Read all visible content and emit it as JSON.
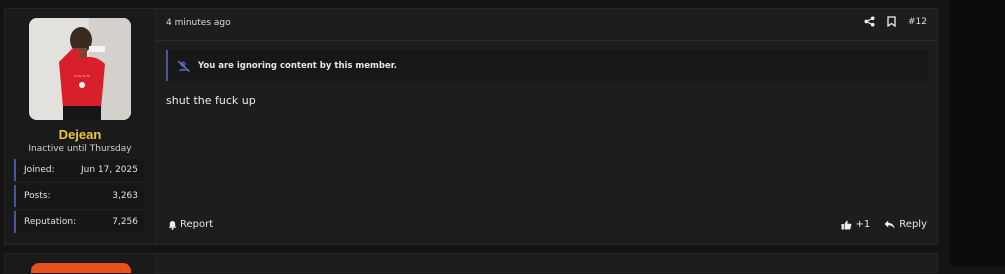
{
  "post": {
    "timestamp": "4 minutes ago",
    "post_number": "#12",
    "ignored_notice": "You are ignoring content by this member.",
    "message": "shut the fuck up",
    "report_label": "Report",
    "reaction_count": "+1",
    "reply_label": "Reply"
  },
  "user": {
    "name": "Dejean",
    "title": "Inactive until Thursday",
    "name_color": "#f0c63b",
    "stats": [
      {
        "label": "Joined:",
        "value": "Jun 17, 2025"
      },
      {
        "label": "Posts:",
        "value": "3,263"
      },
      {
        "label": "Reputation:",
        "value": "7,256"
      }
    ]
  },
  "icons": {
    "share": "share-icon",
    "bookmark": "bookmark-icon",
    "ignore": "ignore-icon",
    "report": "bell-icon",
    "like": "thumbs-up-icon",
    "reply": "reply-arrow-icon"
  },
  "accent_color": "#4a55a0"
}
